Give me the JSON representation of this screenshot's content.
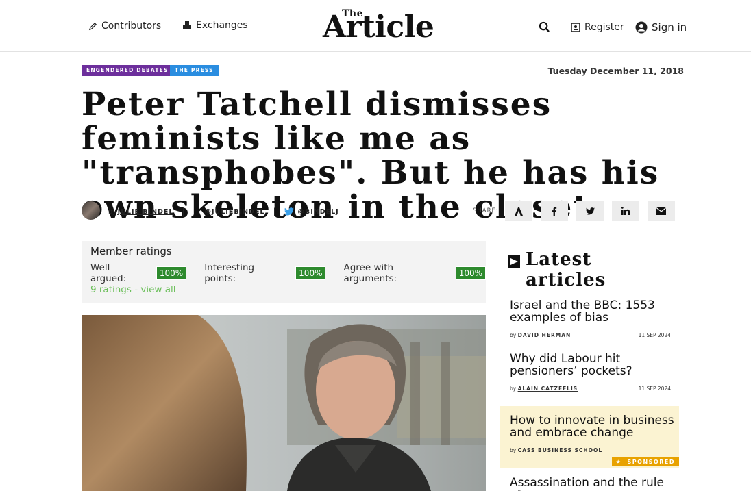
{
  "nav": {
    "contributors": "Contributors",
    "exchanges": "Exchanges",
    "register": "Register",
    "sign_in": "Sign in"
  },
  "logo": {
    "small": "The",
    "big": "Article"
  },
  "tags": [
    "ENGENDERED DEBATES",
    "THE PRESS"
  ],
  "date": "Tuesday December 11, 2018",
  "headline": "Peter Tatchell dismisses feminists like me as \"transphobes\". But he has his own skeleton in the closet.",
  "byline": {
    "by": "by",
    "author": "JULIE BINDEL",
    "sep": "|",
    "article_handle": "@JULIEBINDEL",
    "twitter_handle": "@BINDELJ"
  },
  "share": {
    "label": "SHARE:",
    "buttons": [
      "article-icon",
      "facebook-icon",
      "twitter-icon",
      "linkedin-icon",
      "email-icon"
    ]
  },
  "ratings": {
    "title": "Member ratings",
    "items": [
      {
        "label": "Well argued:",
        "value": "100%"
      },
      {
        "label": "Interesting points:",
        "value": "100%"
      },
      {
        "label": "Agree with arguments:",
        "value": "100%"
      }
    ],
    "link": "9 ratings - view all"
  },
  "latest": {
    "heading": "Latest articles",
    "articles": [
      {
        "title": "Israel and the BBC: 1553 examples of bias",
        "by": "by",
        "author": "DAVID HERMAN",
        "date": "11 SEP 2024"
      },
      {
        "title": "Why did Labour hit pensioners’ pockets?",
        "by": "by",
        "author": "ALAIN CATZEFLIS",
        "date": "11 SEP 2024"
      },
      {
        "title": "How to innovate in business and embrace change",
        "by": "by",
        "author": "CASS BUSINESS SCHOOL",
        "badge": "SPONSORED"
      },
      {
        "title": "Assassination and the rule of"
      }
    ]
  },
  "colors": {
    "purple_tag": "#6d2f9c",
    "blue_tag": "#2a8de0",
    "rating_green": "#2d8a2d",
    "sponsor_gold": "#e8a200"
  }
}
